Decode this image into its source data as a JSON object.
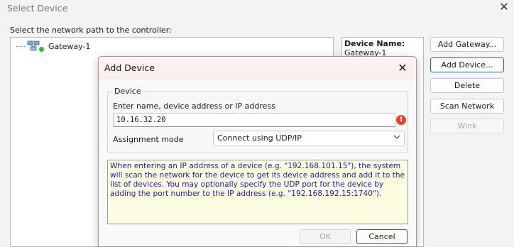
{
  "window": {
    "title": "Select Device",
    "close_glyph": "✕"
  },
  "main": {
    "path_label": "Select the network path to the controller:",
    "tree": {
      "items": [
        {
          "label": "Gateway-1",
          "icon": "network-gateway-icon",
          "status_color": "#2fbf2f"
        }
      ]
    },
    "info": {
      "title": "Device Name:",
      "value": "Gateway-1"
    }
  },
  "side_buttons": {
    "add_gateway": "Add Gateway...",
    "add_device": "Add Device...",
    "delete": "Delete",
    "scan_network": "Scan Network",
    "wink": "Wink"
  },
  "dialog": {
    "title": "Add Device",
    "close_glyph": "✕",
    "group_legend": "Device",
    "address_label": "Enter name, device address or IP address",
    "address_value": "10.16.32.20",
    "error_glyph": "!",
    "mode_label": "Assignment mode",
    "mode_value": "Connect using UDP/IP",
    "help_text": "When entering an IP address of a device (e.g. \"192.168.101.15\"), the system will scan the network for the device to get its device address and add it to the list of devices. You may optionally specify the UDP port for the device by adding the port number to the IP address (e.g. \"192.168.192.15:1740\").",
    "ok_label": "OK",
    "cancel_label": "Cancel"
  },
  "colors": {
    "help_text": "#1a1ab8",
    "help_bg": "#fdfde1",
    "error": "#e2462b",
    "focus": "#1f5fbf"
  }
}
